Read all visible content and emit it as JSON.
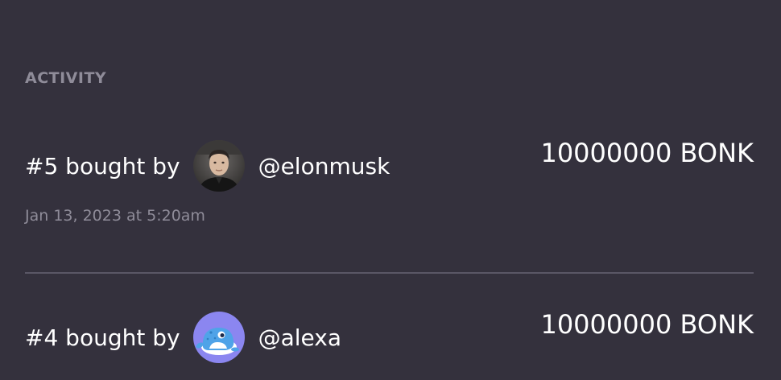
{
  "activity": {
    "title": "ACTIVITY",
    "items": [
      {
        "label": "#5 bought by",
        "username": "@elonmusk",
        "amount": "10000000 BONK",
        "timestamp": "Jan 13, 2023 at 5:20am",
        "avatar_icon": "person-photo-avatar"
      },
      {
        "label": "#4 bought by",
        "username": "@alexa",
        "amount": "10000000 BONK",
        "avatar_icon": "seal-cartoon-avatar",
        "avatar_bg": "#8b86f0"
      }
    ]
  },
  "colors": {
    "background": "#34313d",
    "muted_text": "#8f8c99",
    "divider": "#5a5766"
  }
}
